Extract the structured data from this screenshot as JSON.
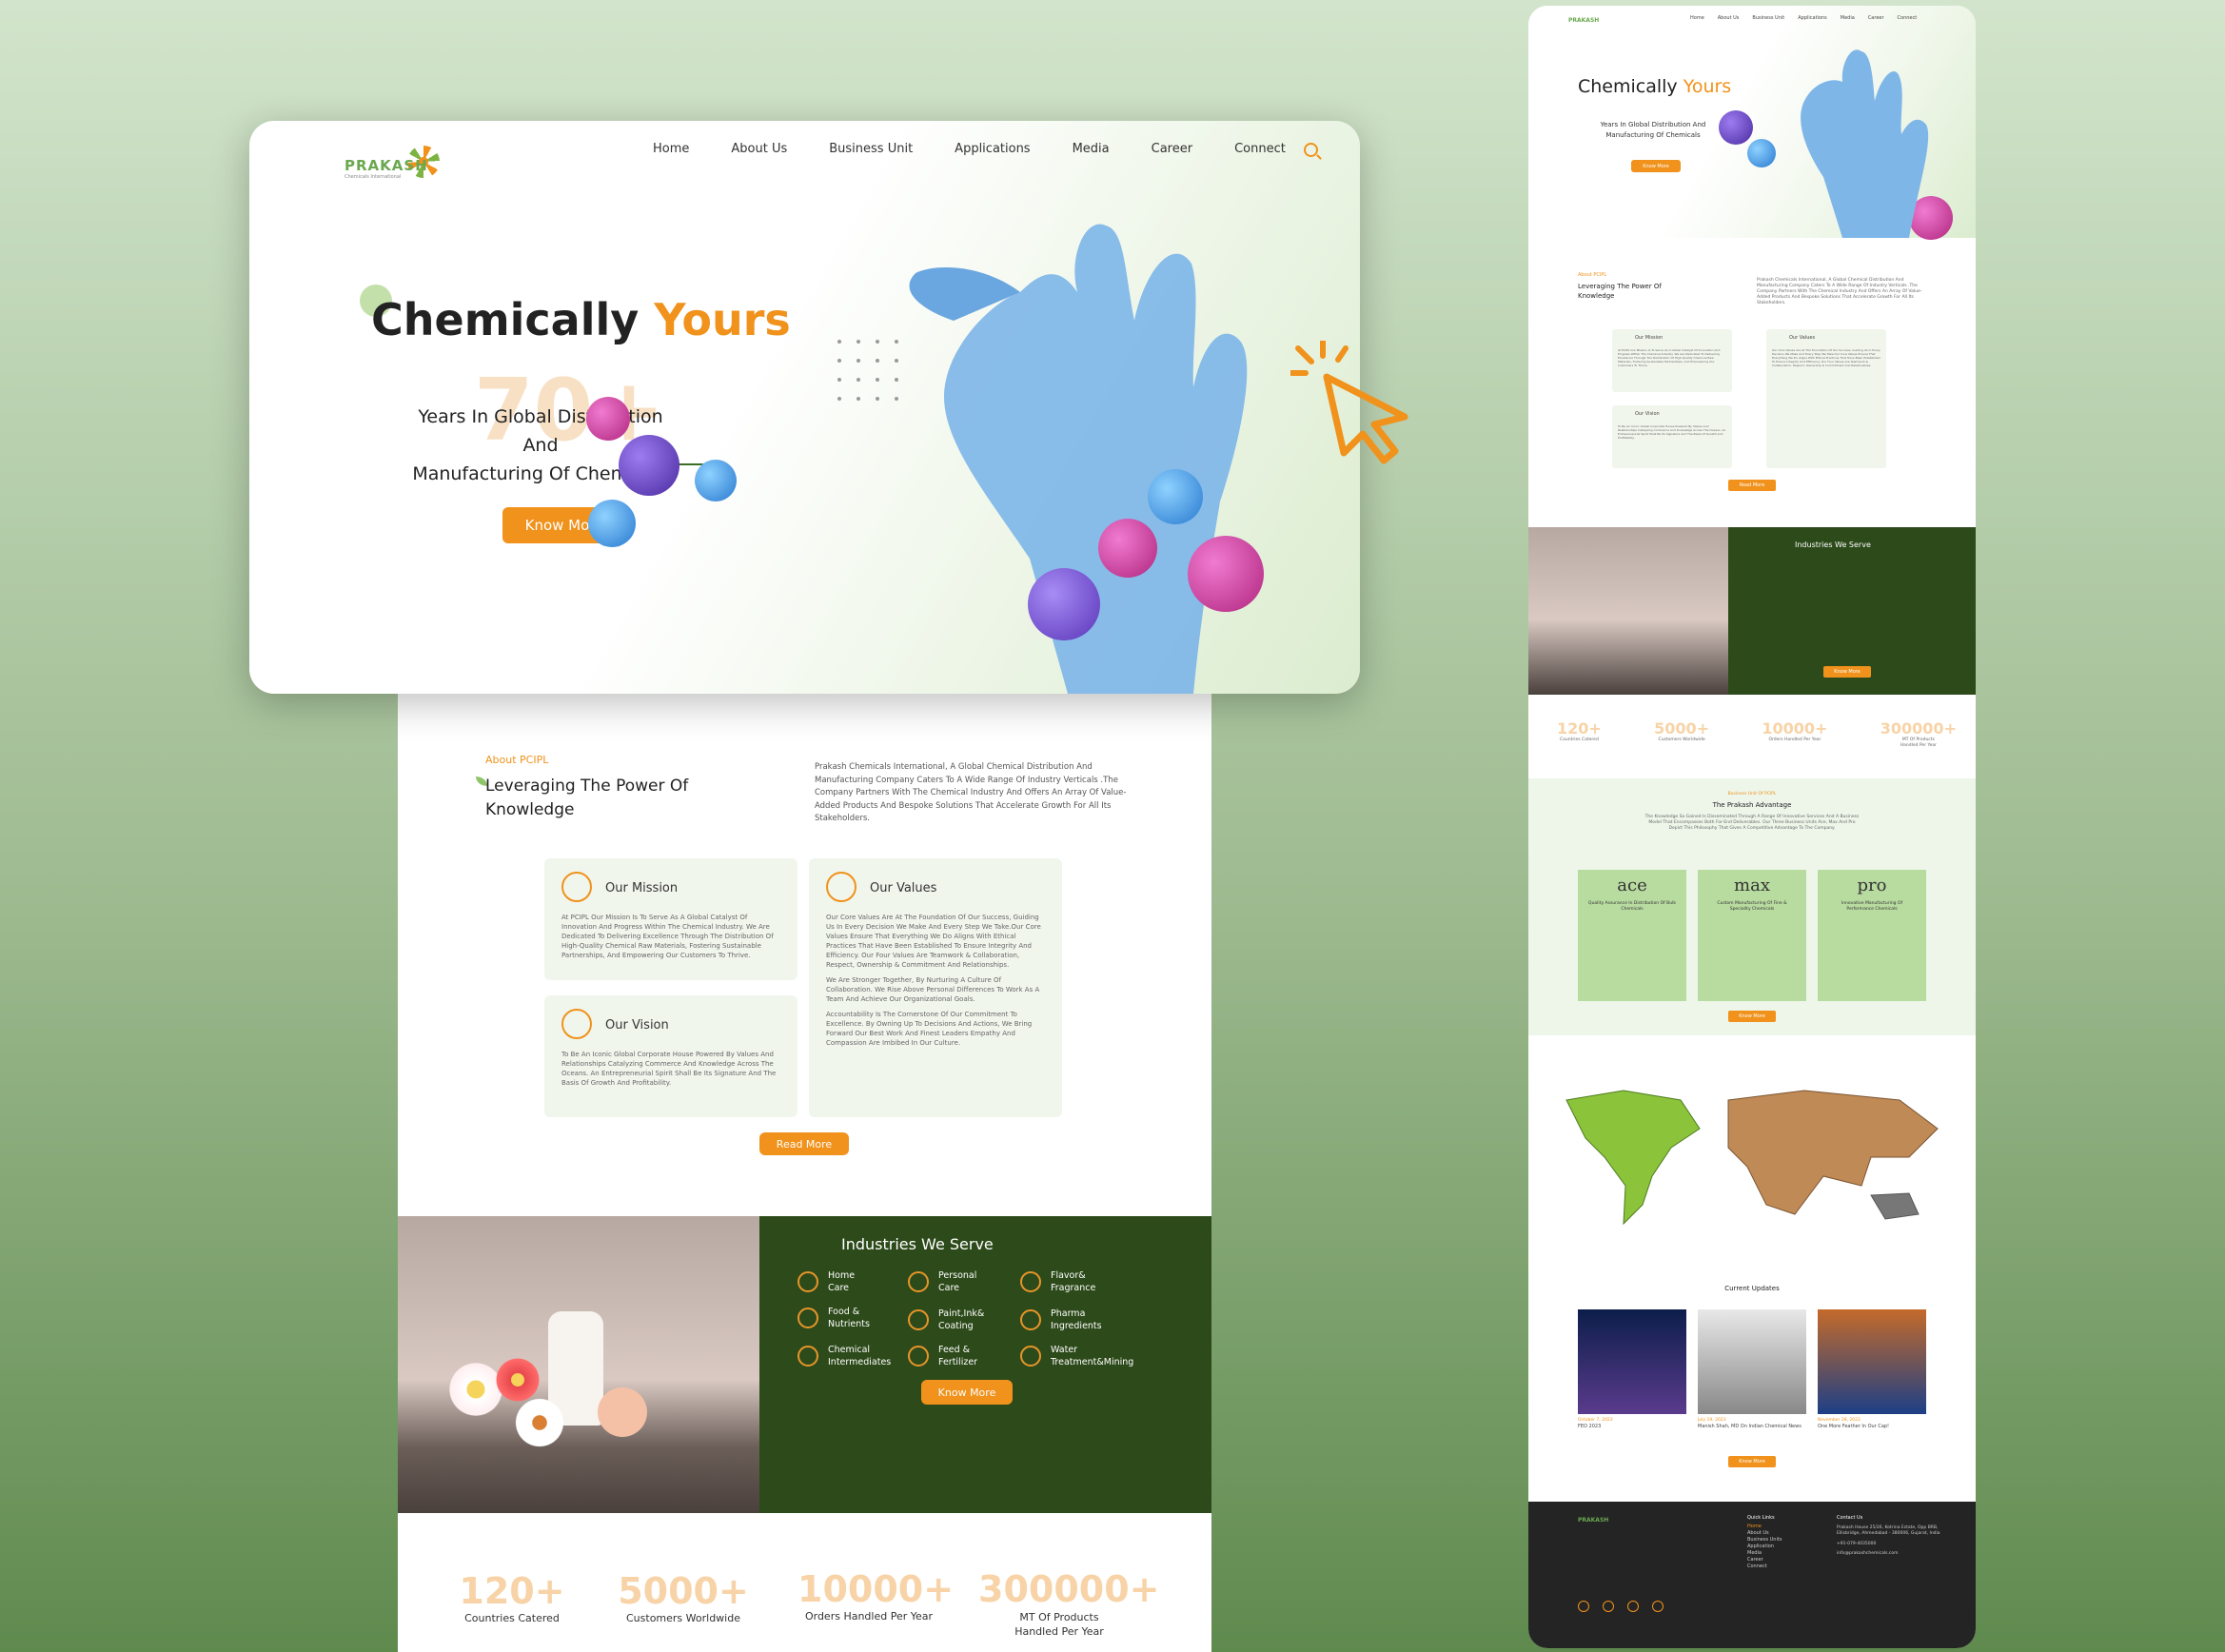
{
  "brand": {
    "name": "PRAKASH",
    "tagline": "Chemicals International"
  },
  "nav": {
    "items": [
      "Home",
      "About Us",
      "Business Unit",
      "Applications",
      "Media",
      "Career",
      "Connect"
    ]
  },
  "hero": {
    "title_plain": "Chemically",
    "title_accent": "Yours",
    "watermark": "70+",
    "subtitle_line1": "Years In Global Distribution And",
    "subtitle_line2": "Manufacturing Of Chemicals",
    "cta": "Know More"
  },
  "about": {
    "eyebrow": "About PCIPL",
    "heading_line1": "Leveraging The Power Of",
    "heading_line2": "Knowledge",
    "body": "Prakash Chemicals International, A Global Chemical Distribution And Manufacturing Company Caters To A Wide Range Of Industry Verticals .The Company Partners With The Chemical Industry And Offers An Array Of Value-Added Products And Bespoke Solutions That Accelerate Growth For All Its Stakeholders.",
    "mission": {
      "title": "Our Mission",
      "body": "At PCIPL Our Mission Is To Serve As A Global Catalyst Of Innovation And Progress Within The Chemical Industry. We Are Dedicated To Delivering Excellence Through The Distribution Of High-Quality Chemical Raw Materials, Fostering Sustainable Partnerships, And Empowering Our Customers To Thrive."
    },
    "values": {
      "title": "Our Values",
      "body1": "Our Core Values Are At The Foundation Of Our Success, Guiding Us In Every Decision We Make And Every Step We Take.Our Core Values Ensure That Everything We Do Aligns With Ethical Practices That Have Been Established To Ensure Integrity And Efficiency. Our Four Values Are Teamwork & Collaboration, Respect, Ownership & Commitment And Relationships.",
      "body2": "We Are Stronger Together, By Nurturing A Culture Of Collaboration. We Rise Above Personal Differences To Work As A Team And Achieve Our Organizational Goals.",
      "body3": "Accountability Is The Cornerstone Of Our Commitment To Excellence. By Owning Up To Decisions And Actions, We Bring Forward Our Best Work And Finest Leaders Empathy And Compassion Are Imbibed In Our Culture."
    },
    "vision": {
      "title": "Our Vision",
      "body": "To Be An Iconic Global Corporate House Powered By Values And Relationships Catalyzing Commerce And Knowledge Across The Oceans. An Entrepreneurial Spirit Shall Be Its Signature And The Basis Of Growth And Profitability."
    },
    "cta": "Read More"
  },
  "industries": {
    "title": "Industries We Serve",
    "items": [
      "Home\nCare",
      "Personal\nCare",
      "Flavor&\nFragrance",
      "Food &\nNutrients",
      "Paint,Ink&\nCoating",
      "Pharma\nIngredients",
      "Chemical\nIntermediates",
      "Feed &\nFertilizer",
      "Water\nTreatment&Mining"
    ],
    "cta": "Know More"
  },
  "stats": [
    {
      "n": "120+",
      "l": "Countries Catered"
    },
    {
      "n": "5000+",
      "l": "Customers Worldwide"
    },
    {
      "n": "10000+",
      "l": "Orders Handled Per Year"
    },
    {
      "n": "300000+",
      "l": "MT Of Products\nHandled Per Year"
    }
  ],
  "advantage": {
    "eyebrow": "Business Unit Of PCIPL",
    "title": "The Prakash Advantage",
    "body": "The Knowledge So Gained Is Disseminated Through A Range Of Innovative Services And A Business Model That Encompasses Both For-End Deliverables. Our Three Business Units Ace, Max And Pro Depict This Philosophy That Gives A Competitive Advantage To The Company.",
    "units": [
      {
        "logo": "ace",
        "desc": "Quality Assurance In Distribution Of Bulk Chemicals"
      },
      {
        "logo": "max",
        "desc": "Custom Manufacturing Of Fine & Speciality Chemicals"
      },
      {
        "logo": "pro",
        "desc": "Innovative Manufacturing Of Performance Chemicals"
      }
    ],
    "cta": "Know More"
  },
  "updates": {
    "title": "Current Updates",
    "items": [
      {
        "date": "October 7, 2023",
        "title": "FEO 2023"
      },
      {
        "date": "July 19, 2023",
        "title": "Manish Shah, MD On Indian Chemical News"
      },
      {
        "date": "November 28, 2022",
        "title": "One More Feather In Our Cap!"
      }
    ],
    "cta": "Know More"
  },
  "footer": {
    "quick_links_title": "Quick Links",
    "links": [
      "Home",
      "About Us",
      "Business Units",
      "Application",
      "Media",
      "Career",
      "Connect"
    ],
    "contact_title": "Contact Us",
    "address": "Prakash House 25/26, Kotrina Estate, Opp BRB, Ellisbridge, Ahmedabad - 380006, Gujarat, India",
    "phone": "+91-079-4035000",
    "email": "info@prakashchemicals.com"
  },
  "colors": {
    "accent": "#f0921b",
    "dark_green": "#2d4a1a",
    "light_green": "#b8dba0",
    "footer": "#242424"
  }
}
